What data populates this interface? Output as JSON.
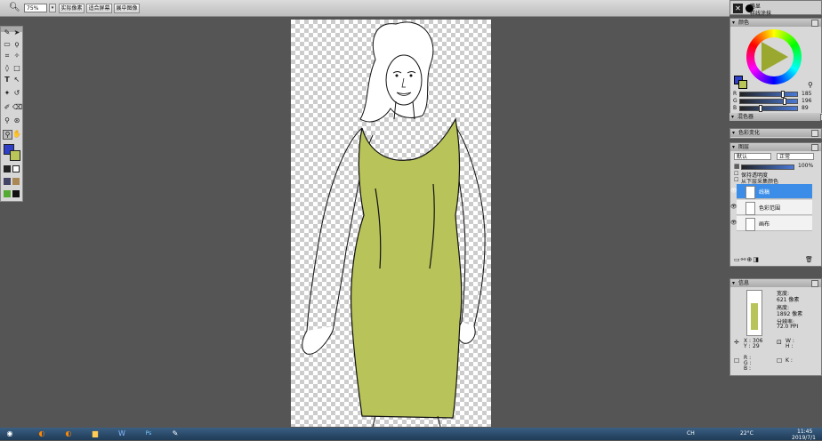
{
  "options_bar": {
    "zoom_value": "75%",
    "buttons": [
      "实际像素",
      "适合屏幕",
      "展中图像"
    ]
  },
  "right_panels": {
    "top": {
      "label1": "略显",
      "label2": "样线涂抹"
    },
    "color": {
      "title": "颜色",
      "channels": [
        {
          "letter": "R",
          "value": "185",
          "fraction": 0.73
        },
        {
          "letter": "G",
          "value": "196",
          "fraction": 0.77
        },
        {
          "letter": "B",
          "value": "89",
          "fraction": 0.35
        }
      ],
      "mixer_title": "混色器",
      "variation_title": "色彩变化",
      "foreground": "#2f3fc8",
      "background": "#b9c459"
    },
    "layers": {
      "title": "图层",
      "mode": "默认",
      "composite": "正常",
      "opacity": "100%",
      "opacity_fraction": 1.0,
      "check1": "保持透明度",
      "check2": "从下层采集颜色",
      "items": [
        {
          "name": "线稿",
          "selected": true
        },
        {
          "name": "色彩范围",
          "selected": false
        },
        {
          "name": "画布",
          "selected": false
        }
      ]
    },
    "info": {
      "title": "信息",
      "width_label": "宽度:",
      "width_value": "621 像素",
      "height_label": "高度:",
      "height_value": "1892 像素",
      "res_label": "分辨率:",
      "res_value": "72.0 PPI",
      "x_label": "X :",
      "x_value": "306",
      "y_label": "Y :",
      "y_value": "29",
      "w_label": "W :",
      "h_label": "H :",
      "r_label": "R :",
      "g_label": "G :",
      "b_label": "B :",
      "k_label": "K :"
    }
  },
  "taskbar": {
    "time": "11:45",
    "date": "2019/7/1",
    "lang": "CH",
    "weather": "22°C"
  },
  "colors": {
    "dress": "#b8c35a",
    "selection": "#3b8de8"
  }
}
